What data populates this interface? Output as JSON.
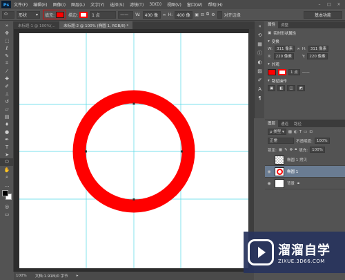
{
  "menubar": {
    "logo": "Ps",
    "items": [
      "文件(F)",
      "编辑(E)",
      "图像(I)",
      "图层(L)",
      "文字(Y)",
      "选择(S)",
      "滤镜(T)",
      "3D(D)",
      "视图(V)",
      "窗口(W)",
      "帮助(H)"
    ],
    "window_buttons": [
      "–",
      "□",
      "×"
    ]
  },
  "options": {
    "mode": "形状",
    "fill_label": "填充:",
    "stroke_label": "描边:",
    "stroke_width": "1 点",
    "w_label": "W:",
    "w_value": "400 像",
    "link_icon": "∞",
    "h_label": "H:",
    "h_value": "400 像",
    "align_edges": "对齐边缘",
    "workspace": "基本功能",
    "fill_color": "#ff0000"
  },
  "tabs": [
    {
      "label": "未标题-1 @ 100%(...",
      "active": false
    },
    {
      "label": "未标题-2 @ 100% (椭圆 1, RGB/8) *",
      "active": true
    }
  ],
  "canvas": {
    "ring_color": "#ff0000",
    "guide_color": "#4fd8e6"
  },
  "status": {
    "zoom": "100%",
    "doc": "文档:1.91M/0 字节"
  },
  "properties": {
    "tabs": [
      "属性",
      "调整"
    ],
    "title": "实时形状属性",
    "section_transform": "变换",
    "w": "311 像素",
    "h": "311 像素",
    "x": "220 像素",
    "y": "220 像素",
    "w_label": "W:",
    "h_label": "H:",
    "x_label": "X:",
    "y_label": "Y:",
    "section_appearance": "外观",
    "stroke_size": "1 点",
    "section_path_ops": "路径操作"
  },
  "layers": {
    "tabs": [
      "图层",
      "通道",
      "路径"
    ],
    "kind_filter": "类型",
    "blend_mode": "正常",
    "opacity_label": "不透明度:",
    "opacity": "100%",
    "lock_label": "锁定:",
    "fill_label": "填充:",
    "fill_value": "100%",
    "items": [
      {
        "name": "椭圆 1 拷贝",
        "selected": false,
        "visible": false
      },
      {
        "name": "椭圆 1",
        "selected": true,
        "visible": true
      },
      {
        "name": "背景",
        "selected": false,
        "visible": true
      }
    ]
  },
  "watermark": {
    "cn": "溜溜自学",
    "url": "ZIXUE.3D66.COM"
  }
}
